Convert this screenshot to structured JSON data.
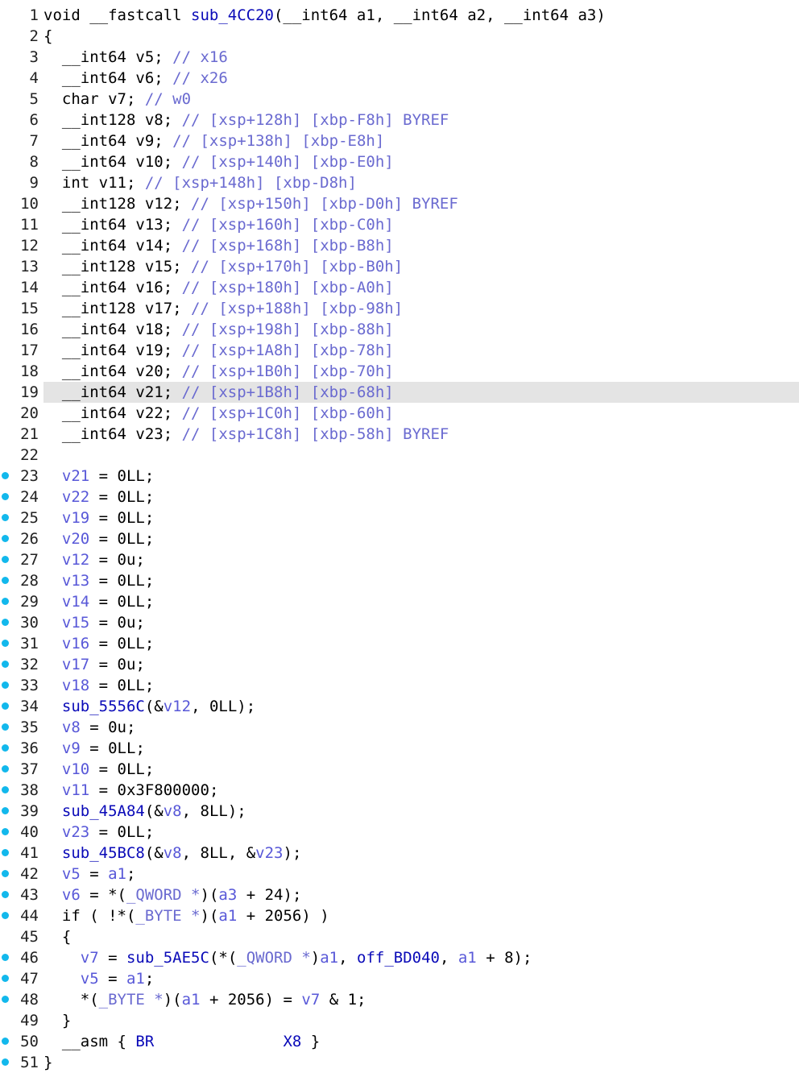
{
  "colors": {
    "keyword": "#000000",
    "comment": "#6a6ad0",
    "variable": "#5858d8",
    "function": "#0a0ab8",
    "number": "#000000",
    "breakpoint_dot": "#12b8ec",
    "highlight_line": "#e4e4e4"
  },
  "editor": {
    "highlighted_line": 19,
    "lines": [
      {
        "n": "1",
        "bp": false,
        "indent": "",
        "tokens": [
          [
            "k",
            "void __fastcall "
          ],
          [
            "d",
            "sub_4CC20"
          ],
          [
            "k",
            "(__int64 a1, __int64 a2, __int64 a3)"
          ]
        ]
      },
      {
        "n": "2",
        "bp": false,
        "indent": "",
        "tokens": [
          [
            "p",
            "{"
          ]
        ]
      },
      {
        "n": "3",
        "bp": false,
        "indent": "  ",
        "tokens": [
          [
            "k",
            "__int64 v5; "
          ],
          [
            "c",
            "// x16"
          ]
        ]
      },
      {
        "n": "4",
        "bp": false,
        "indent": "  ",
        "tokens": [
          [
            "k",
            "__int64 v6; "
          ],
          [
            "c",
            "// x26"
          ]
        ]
      },
      {
        "n": "5",
        "bp": false,
        "indent": "  ",
        "tokens": [
          [
            "k",
            "char v7; "
          ],
          [
            "c",
            "// w0"
          ]
        ]
      },
      {
        "n": "6",
        "bp": false,
        "indent": "  ",
        "tokens": [
          [
            "k",
            "__int128 v8; "
          ],
          [
            "c",
            "// [xsp+128h] [xbp-F8h] BYREF"
          ]
        ]
      },
      {
        "n": "7",
        "bp": false,
        "indent": "  ",
        "tokens": [
          [
            "k",
            "__int64 v9; "
          ],
          [
            "c",
            "// [xsp+138h] [xbp-E8h]"
          ]
        ]
      },
      {
        "n": "8",
        "bp": false,
        "indent": "  ",
        "tokens": [
          [
            "k",
            "__int64 v10; "
          ],
          [
            "c",
            "// [xsp+140h] [xbp-E0h]"
          ]
        ]
      },
      {
        "n": "9",
        "bp": false,
        "indent": "  ",
        "tokens": [
          [
            "k",
            "int v11; "
          ],
          [
            "c",
            "// [xsp+148h] [xbp-D8h]"
          ]
        ]
      },
      {
        "n": "10",
        "bp": false,
        "indent": "  ",
        "tokens": [
          [
            "k",
            "__int128 v12; "
          ],
          [
            "c",
            "// [xsp+150h] [xbp-D0h] BYREF"
          ]
        ]
      },
      {
        "n": "11",
        "bp": false,
        "indent": "  ",
        "tokens": [
          [
            "k",
            "__int64 v13; "
          ],
          [
            "c",
            "// [xsp+160h] [xbp-C0h]"
          ]
        ]
      },
      {
        "n": "12",
        "bp": false,
        "indent": "  ",
        "tokens": [
          [
            "k",
            "__int64 v14; "
          ],
          [
            "c",
            "// [xsp+168h] [xbp-B8h]"
          ]
        ]
      },
      {
        "n": "13",
        "bp": false,
        "indent": "  ",
        "tokens": [
          [
            "k",
            "__int128 v15; "
          ],
          [
            "c",
            "// [xsp+170h] [xbp-B0h]"
          ]
        ]
      },
      {
        "n": "14",
        "bp": false,
        "indent": "  ",
        "tokens": [
          [
            "k",
            "__int64 v16; "
          ],
          [
            "c",
            "// [xsp+180h] [xbp-A0h]"
          ]
        ]
      },
      {
        "n": "15",
        "bp": false,
        "indent": "  ",
        "tokens": [
          [
            "k",
            "__int128 v17; "
          ],
          [
            "c",
            "// [xsp+188h] [xbp-98h]"
          ]
        ]
      },
      {
        "n": "16",
        "bp": false,
        "indent": "  ",
        "tokens": [
          [
            "k",
            "__int64 v18; "
          ],
          [
            "c",
            "// [xsp+198h] [xbp-88h]"
          ]
        ]
      },
      {
        "n": "17",
        "bp": false,
        "indent": "  ",
        "tokens": [
          [
            "k",
            "__int64 v19; "
          ],
          [
            "c",
            "// [xsp+1A8h] [xbp-78h]"
          ]
        ]
      },
      {
        "n": "18",
        "bp": false,
        "indent": "  ",
        "tokens": [
          [
            "k",
            "__int64 v20; "
          ],
          [
            "c",
            "// [xsp+1B0h] [xbp-70h]"
          ]
        ]
      },
      {
        "n": "19",
        "bp": false,
        "indent": "  ",
        "tokens": [
          [
            "k",
            "__int64 v21; "
          ],
          [
            "c",
            "// [xsp+1B8h] [xbp-68h]"
          ]
        ]
      },
      {
        "n": "20",
        "bp": false,
        "indent": "  ",
        "tokens": [
          [
            "k",
            "__int64 v22; "
          ],
          [
            "c",
            "// [xsp+1C0h] [xbp-60h]"
          ]
        ]
      },
      {
        "n": "21",
        "bp": false,
        "indent": "  ",
        "tokens": [
          [
            "k",
            "__int64 v23; "
          ],
          [
            "c",
            "// [xsp+1C8h] [xbp-58h] BYREF"
          ]
        ]
      },
      {
        "n": "22",
        "bp": false,
        "indent": "",
        "tokens": []
      },
      {
        "n": "23",
        "bp": true,
        "indent": "  ",
        "tokens": [
          [
            "v",
            "v21"
          ],
          [
            "p",
            " = "
          ],
          [
            "n",
            "0LL"
          ],
          [
            "p",
            ";"
          ]
        ]
      },
      {
        "n": "24",
        "bp": true,
        "indent": "  ",
        "tokens": [
          [
            "v",
            "v22"
          ],
          [
            "p",
            " = "
          ],
          [
            "n",
            "0LL"
          ],
          [
            "p",
            ";"
          ]
        ]
      },
      {
        "n": "25",
        "bp": true,
        "indent": "  ",
        "tokens": [
          [
            "v",
            "v19"
          ],
          [
            "p",
            " = "
          ],
          [
            "n",
            "0LL"
          ],
          [
            "p",
            ";"
          ]
        ]
      },
      {
        "n": "26",
        "bp": true,
        "indent": "  ",
        "tokens": [
          [
            "v",
            "v20"
          ],
          [
            "p",
            " = "
          ],
          [
            "n",
            "0LL"
          ],
          [
            "p",
            ";"
          ]
        ]
      },
      {
        "n": "27",
        "bp": true,
        "indent": "  ",
        "tokens": [
          [
            "v",
            "v12"
          ],
          [
            "p",
            " = "
          ],
          [
            "n",
            "0u"
          ],
          [
            "p",
            ";"
          ]
        ]
      },
      {
        "n": "28",
        "bp": true,
        "indent": "  ",
        "tokens": [
          [
            "v",
            "v13"
          ],
          [
            "p",
            " = "
          ],
          [
            "n",
            "0LL"
          ],
          [
            "p",
            ";"
          ]
        ]
      },
      {
        "n": "29",
        "bp": true,
        "indent": "  ",
        "tokens": [
          [
            "v",
            "v14"
          ],
          [
            "p",
            " = "
          ],
          [
            "n",
            "0LL"
          ],
          [
            "p",
            ";"
          ]
        ]
      },
      {
        "n": "30",
        "bp": true,
        "indent": "  ",
        "tokens": [
          [
            "v",
            "v15"
          ],
          [
            "p",
            " = "
          ],
          [
            "n",
            "0u"
          ],
          [
            "p",
            ";"
          ]
        ]
      },
      {
        "n": "31",
        "bp": true,
        "indent": "  ",
        "tokens": [
          [
            "v",
            "v16"
          ],
          [
            "p",
            " = "
          ],
          [
            "n",
            "0LL"
          ],
          [
            "p",
            ";"
          ]
        ]
      },
      {
        "n": "32",
        "bp": true,
        "indent": "  ",
        "tokens": [
          [
            "v",
            "v17"
          ],
          [
            "p",
            " = "
          ],
          [
            "n",
            "0u"
          ],
          [
            "p",
            ";"
          ]
        ]
      },
      {
        "n": "33",
        "bp": true,
        "indent": "  ",
        "tokens": [
          [
            "v",
            "v18"
          ],
          [
            "p",
            " = "
          ],
          [
            "n",
            "0LL"
          ],
          [
            "p",
            ";"
          ]
        ]
      },
      {
        "n": "34",
        "bp": true,
        "indent": "  ",
        "tokens": [
          [
            "f",
            "sub_5556C"
          ],
          [
            "p",
            "(&"
          ],
          [
            "v",
            "v12"
          ],
          [
            "p",
            ", "
          ],
          [
            "n",
            "0LL"
          ],
          [
            "p",
            ");"
          ]
        ]
      },
      {
        "n": "35",
        "bp": true,
        "indent": "  ",
        "tokens": [
          [
            "v",
            "v8"
          ],
          [
            "p",
            " = "
          ],
          [
            "n",
            "0u"
          ],
          [
            "p",
            ";"
          ]
        ]
      },
      {
        "n": "36",
        "bp": true,
        "indent": "  ",
        "tokens": [
          [
            "v",
            "v9"
          ],
          [
            "p",
            " = "
          ],
          [
            "n",
            "0LL"
          ],
          [
            "p",
            ";"
          ]
        ]
      },
      {
        "n": "37",
        "bp": true,
        "indent": "  ",
        "tokens": [
          [
            "v",
            "v10"
          ],
          [
            "p",
            " = "
          ],
          [
            "n",
            "0LL"
          ],
          [
            "p",
            ";"
          ]
        ]
      },
      {
        "n": "38",
        "bp": true,
        "indent": "  ",
        "tokens": [
          [
            "v",
            "v11"
          ],
          [
            "p",
            " = "
          ],
          [
            "n",
            "0x3F800000"
          ],
          [
            "p",
            ";"
          ]
        ]
      },
      {
        "n": "39",
        "bp": true,
        "indent": "  ",
        "tokens": [
          [
            "f",
            "sub_45A84"
          ],
          [
            "p",
            "(&"
          ],
          [
            "v",
            "v8"
          ],
          [
            "p",
            ", "
          ],
          [
            "n",
            "8LL"
          ],
          [
            "p",
            ");"
          ]
        ]
      },
      {
        "n": "40",
        "bp": true,
        "indent": "  ",
        "tokens": [
          [
            "v",
            "v23"
          ],
          [
            "p",
            " = "
          ],
          [
            "n",
            "0LL"
          ],
          [
            "p",
            ";"
          ]
        ]
      },
      {
        "n": "41",
        "bp": true,
        "indent": "  ",
        "tokens": [
          [
            "f",
            "sub_45BC8"
          ],
          [
            "p",
            "(&"
          ],
          [
            "v",
            "v8"
          ],
          [
            "p",
            ", "
          ],
          [
            "n",
            "8LL"
          ],
          [
            "p",
            ", &"
          ],
          [
            "v",
            "v23"
          ],
          [
            "p",
            ");"
          ]
        ]
      },
      {
        "n": "42",
        "bp": true,
        "indent": "  ",
        "tokens": [
          [
            "v",
            "v5"
          ],
          [
            "p",
            " = "
          ],
          [
            "v",
            "a1"
          ],
          [
            "p",
            ";"
          ]
        ]
      },
      {
        "n": "43",
        "bp": true,
        "indent": "  ",
        "tokens": [
          [
            "v",
            "v6"
          ],
          [
            "p",
            " = *("
          ],
          [
            "c",
            "_QWORD *"
          ],
          [
            "p",
            ")("
          ],
          [
            "v",
            "a3"
          ],
          [
            "p",
            " + "
          ],
          [
            "n",
            "24"
          ],
          [
            "p",
            ");"
          ]
        ]
      },
      {
        "n": "44",
        "bp": true,
        "indent": "  ",
        "tokens": [
          [
            "k",
            "if"
          ],
          [
            "p",
            " ( !*("
          ],
          [
            "c",
            "_BYTE *"
          ],
          [
            "p",
            ")("
          ],
          [
            "v",
            "a1"
          ],
          [
            "p",
            " + "
          ],
          [
            "n",
            "2056"
          ],
          [
            "p",
            ") )"
          ]
        ]
      },
      {
        "n": "45",
        "bp": false,
        "indent": "  ",
        "tokens": [
          [
            "p",
            "{"
          ]
        ]
      },
      {
        "n": "46",
        "bp": true,
        "indent": "    ",
        "tokens": [
          [
            "v",
            "v7"
          ],
          [
            "p",
            " = "
          ],
          [
            "f",
            "sub_5AE5C"
          ],
          [
            "p",
            "(*("
          ],
          [
            "c",
            "_QWORD *"
          ],
          [
            "p",
            ")"
          ],
          [
            "v",
            "a1"
          ],
          [
            "p",
            ", "
          ],
          [
            "f",
            "off_BD040"
          ],
          [
            "p",
            ", "
          ],
          [
            "v",
            "a1"
          ],
          [
            "p",
            " + "
          ],
          [
            "n",
            "8"
          ],
          [
            "p",
            ");"
          ]
        ]
      },
      {
        "n": "47",
        "bp": true,
        "indent": "    ",
        "tokens": [
          [
            "v",
            "v5"
          ],
          [
            "p",
            " = "
          ],
          [
            "v",
            "a1"
          ],
          [
            "p",
            ";"
          ]
        ]
      },
      {
        "n": "48",
        "bp": true,
        "indent": "    ",
        "tokens": [
          [
            "p",
            "*("
          ],
          [
            "c",
            "_BYTE *"
          ],
          [
            "p",
            ")("
          ],
          [
            "v",
            "a1"
          ],
          [
            "p",
            " + "
          ],
          [
            "n",
            "2056"
          ],
          [
            "p",
            ") = "
          ],
          [
            "v",
            "v7"
          ],
          [
            "p",
            " & "
          ],
          [
            "n",
            "1"
          ],
          [
            "p",
            ";"
          ]
        ]
      },
      {
        "n": "49",
        "bp": false,
        "indent": "  ",
        "tokens": [
          [
            "p",
            "}"
          ]
        ]
      },
      {
        "n": "50",
        "bp": true,
        "indent": "  ",
        "tokens": [
          [
            "k",
            "__asm"
          ],
          [
            "p",
            " { "
          ],
          [
            "f",
            "BR"
          ],
          [
            "p",
            "              "
          ],
          [
            "f",
            "X8"
          ],
          [
            "p",
            " }"
          ]
        ]
      },
      {
        "n": "51",
        "bp": true,
        "indent": "",
        "tokens": [
          [
            "p",
            "}"
          ]
        ]
      }
    ]
  }
}
